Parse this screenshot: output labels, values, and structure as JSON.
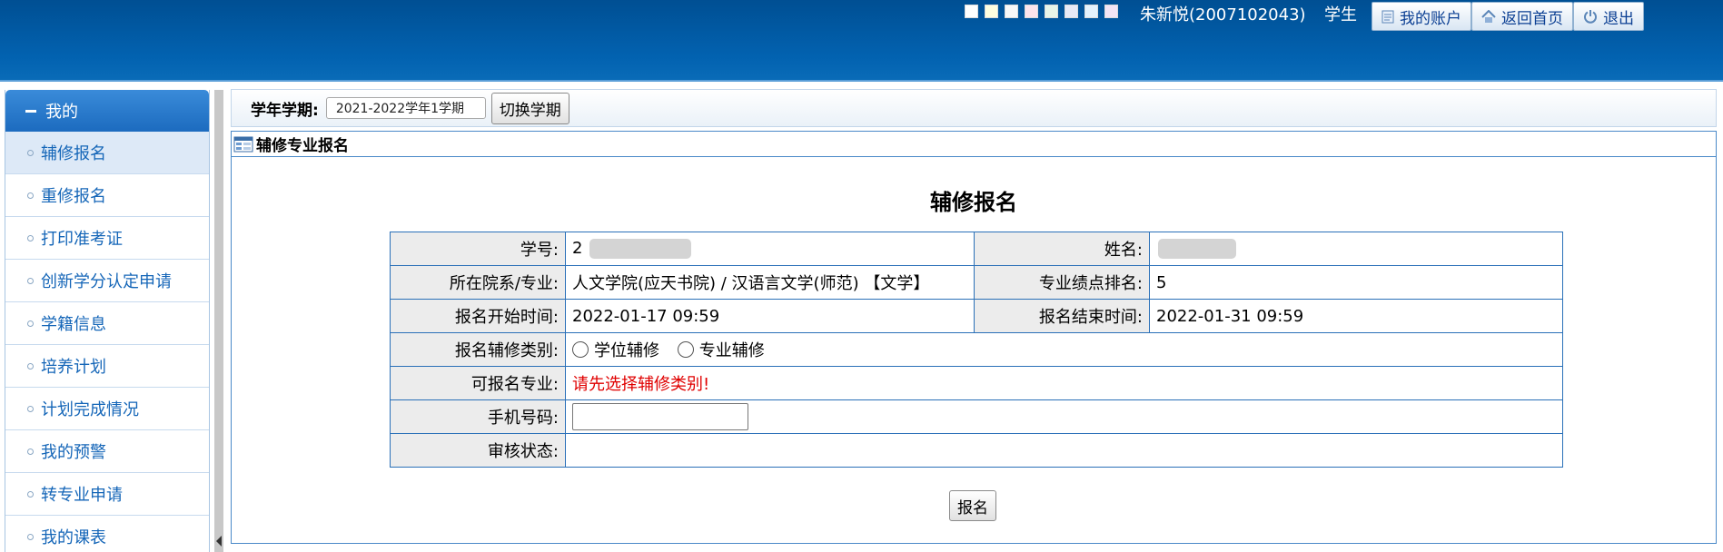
{
  "header": {
    "swatch_colors": [
      "#ffffff",
      "#ffffe0",
      "#f8f8f8",
      "#fce4ec",
      "#e8f5e9",
      "#e8eaf6",
      "#e3f2fd",
      "#f3e5f5"
    ],
    "user_name": "朱新悦(2007102043)",
    "user_role": "学生",
    "buttons": [
      {
        "label": "我的账户",
        "icon": "account-icon"
      },
      {
        "label": "返回首页",
        "icon": "home-icon"
      },
      {
        "label": "退出",
        "icon": "power-icon"
      }
    ]
  },
  "sidebar": {
    "header": "我的",
    "items": [
      {
        "label": "辅修报名"
      },
      {
        "label": "重修报名"
      },
      {
        "label": "打印准考证"
      },
      {
        "label": "创新学分认定申请"
      },
      {
        "label": "学籍信息"
      },
      {
        "label": "培养计划"
      },
      {
        "label": "计划完成情况"
      },
      {
        "label": "我的预警"
      },
      {
        "label": "转专业申请"
      },
      {
        "label": "我的课表"
      }
    ],
    "active_index": 0
  },
  "term_bar": {
    "label": "学年学期:",
    "value": "2021-2022学年1学期",
    "switch_button": "切换学期"
  },
  "panel": {
    "title": "辅修专业报名",
    "form_title": "辅修报名",
    "rows": {
      "student_id_label": "学号:",
      "student_id_value": "2",
      "name_label": "姓名:",
      "dept_label": "所在院系/专业:",
      "dept_value": "人文学院(应天书院) / 汉语言文学(师范) 【文学】",
      "rank_label": "专业绩点排名:",
      "rank_value": "5",
      "start_label": "报名开始时间:",
      "start_value": "2022-01-17 09:59",
      "end_label": "报名结束时间:",
      "end_value": "2022-01-31 09:59",
      "type_label": "报名辅修类别:",
      "type_options": [
        "学位辅修",
        "专业辅修"
      ],
      "major_label": "可报名专业:",
      "major_hint": "请先选择辅修类别!",
      "phone_label": "手机号码:",
      "phone_value": "",
      "status_label": "审核状态:",
      "status_value": ""
    },
    "submit_button": "报名"
  }
}
